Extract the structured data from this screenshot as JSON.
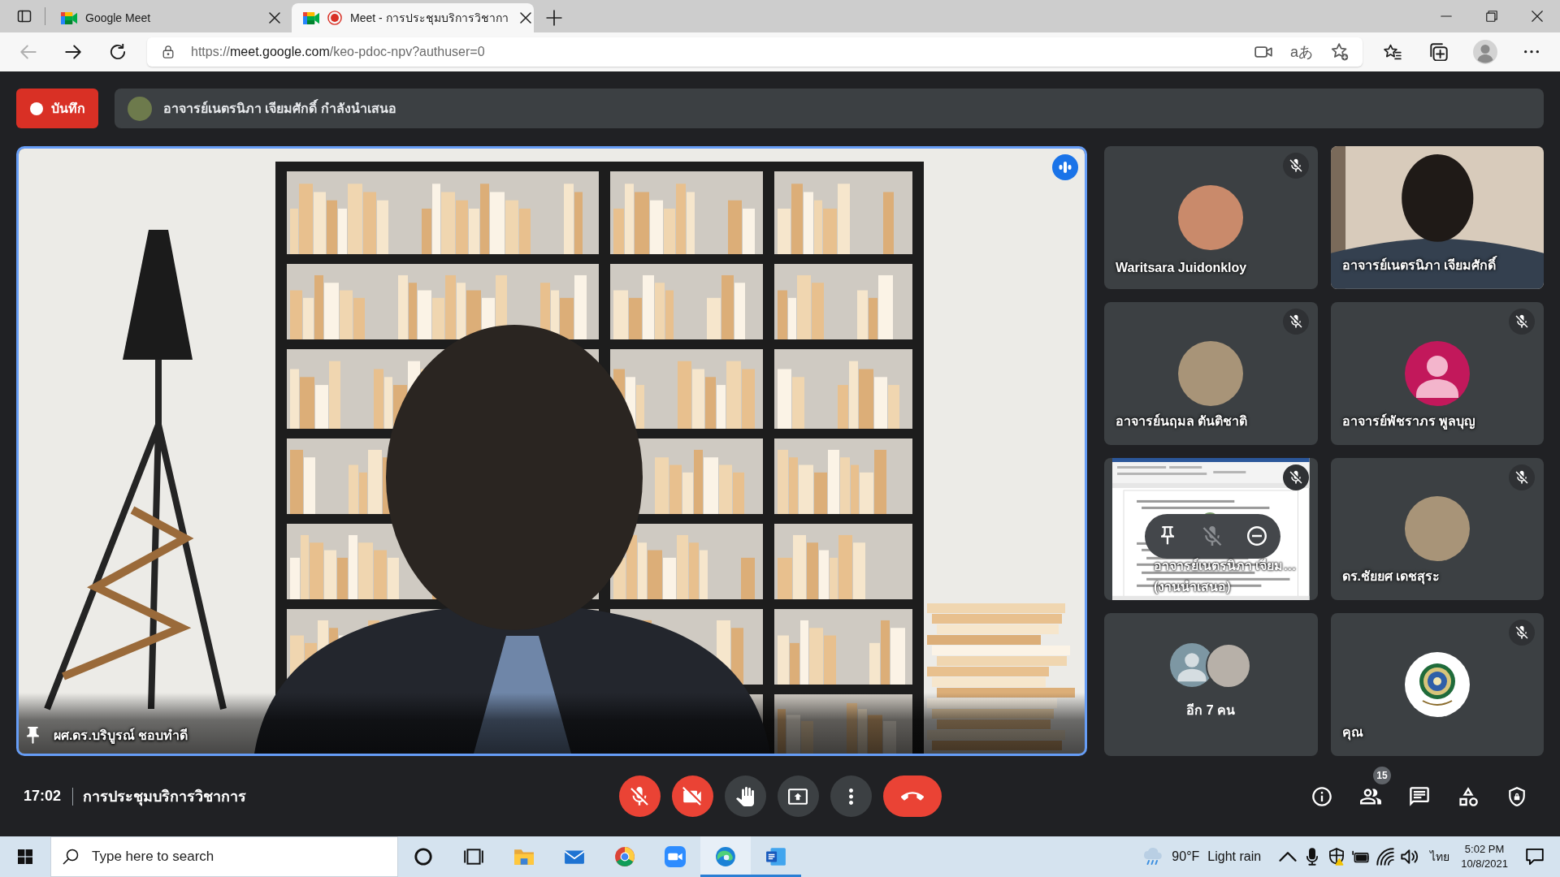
{
  "browser": {
    "tabs": [
      {
        "title": "Google Meet",
        "selected": false,
        "recording": false
      },
      {
        "title": "Meet - การประชุมบริการวิชากา",
        "selected": true,
        "recording": true
      }
    ],
    "nav_buttons": [
      {
        "kind": "back",
        "disabled": true
      },
      {
        "kind": "forward",
        "disabled": false
      },
      {
        "kind": "reload",
        "disabled": false
      }
    ],
    "address": {
      "scheme": "https://",
      "host": "meet.google.com",
      "path": "/keo-pdoc-npv?authuser=0"
    },
    "read_aloud_glyph": "aあ"
  },
  "meeting": {
    "record_button": "บันทึก",
    "presenting_banner": "อาจารย์เนตรนิภา เจียมศักดิ์ กำลังนำเสนอ",
    "main_video": {
      "name": "ผศ.ดร.บริบูรณ์ ชอบทำดี",
      "speaking": true,
      "pinned": true
    },
    "tiles": [
      {
        "kind": "photo",
        "name": "Waritsara Juidonkloy",
        "muted": true
      },
      {
        "kind": "video",
        "name": "อาจารย์เนตรนิภา เจียมศักดิ์",
        "muted": false
      },
      {
        "kind": "photo",
        "name": "อาจารย์นฤมล ตันติชาติ",
        "muted": true
      },
      {
        "kind": "default",
        "name": "อาจารย์พัชราภร พูลบุญ",
        "muted": true,
        "color": "#c2185b"
      },
      {
        "kind": "screen",
        "name": "อาจารย์เนตรนิภา เจียม…",
        "note": "(งานนำเสนอ)",
        "muted": true,
        "hover_actions": [
          {
            "kind": "pin",
            "disabled": false
          },
          {
            "kind": "mute",
            "disabled": true
          },
          {
            "kind": "remove",
            "disabled": false
          }
        ]
      },
      {
        "kind": "photo",
        "name": "ดร.ชัยยศ เดชสุระ",
        "muted": true
      },
      {
        "kind": "others",
        "name": "อีก 7 คน",
        "muted": false
      },
      {
        "kind": "logo",
        "name": "คุณ",
        "muted": true
      }
    ],
    "time": "17:02",
    "title": "การประชุมบริการวิชาการ",
    "controls": [
      {
        "kind": "mic",
        "on": false
      },
      {
        "kind": "camera",
        "on": false
      },
      {
        "kind": "hand"
      },
      {
        "kind": "present"
      },
      {
        "kind": "more"
      },
      {
        "kind": "leave"
      }
    ],
    "side_buttons": [
      {
        "kind": "info"
      },
      {
        "kind": "people",
        "badge": "15"
      },
      {
        "kind": "chat"
      },
      {
        "kind": "activities"
      },
      {
        "kind": "host"
      }
    ]
  },
  "taskbar": {
    "search": {
      "placeholder": "Type here to search"
    },
    "apps": [
      {
        "kind": "ring",
        "running": false,
        "selected": false
      },
      {
        "kind": "tasks",
        "running": false,
        "selected": false
      },
      {
        "kind": "folder",
        "running": false,
        "selected": false
      },
      {
        "kind": "mail",
        "running": false,
        "selected": false
      },
      {
        "kind": "globe",
        "running": false,
        "selected": false
      },
      {
        "kind": "camera",
        "running": false,
        "selected": false
      },
      {
        "kind": "wave",
        "running": true,
        "selected": true
      },
      {
        "kind": "document",
        "running": true,
        "selected": false
      }
    ],
    "weather": {
      "temperature": "90°F",
      "condition": "Light rain"
    },
    "language": "ไทย",
    "time": "5:02 PM",
    "date": "10/8/2021"
  }
}
